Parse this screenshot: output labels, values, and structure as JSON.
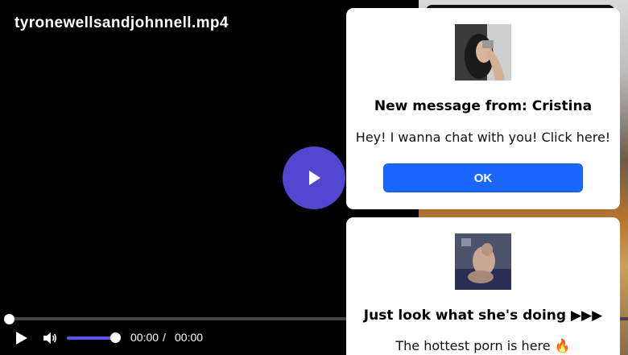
{
  "video": {
    "title": "tyronewellsandjohnnell.mp4",
    "progress_fraction": 0.0,
    "volume_fraction": 1.0,
    "current_time": "00:00",
    "separator": "/",
    "total_time": "00:00"
  },
  "icons": {
    "big_play": "play-icon",
    "play": "play-icon",
    "volume": "volume-icon"
  },
  "colors": {
    "play_button": "#5146d0",
    "ok_button": "#1a66ff",
    "volume_fill": "#5c57e8"
  },
  "popups": [
    {
      "title": "New message from: Cristina",
      "body": "Hey! I wanna chat with you! Click here!",
      "button_label": "OK"
    },
    {
      "title": "Just look what she's doing ▶▶▶",
      "body": "The hottest porn is here 🔥"
    }
  ]
}
